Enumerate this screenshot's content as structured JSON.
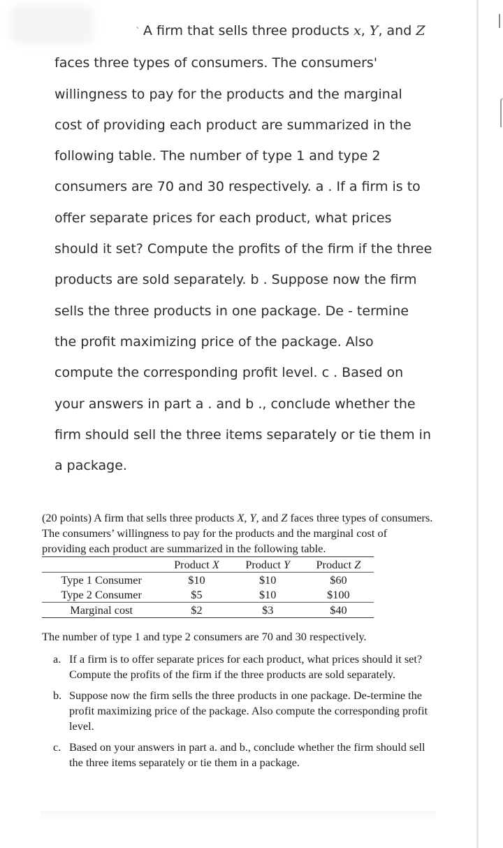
{
  "question": {
    "lines": [
      "A firm that sells three products",
      "faces three types of consumers. The consumers'",
      "willingness to pay for the products and the marginal",
      "cost of providing each product are summarized in the",
      "following table. The number of type 1 and type 2",
      "consumers are 70 and 30 respectively. a . If a firm is to",
      "offer separate prices for each product, what prices",
      "should it set? Compute the profits of the firm if the three",
      "products are sold separately. b . Suppose now the firm",
      "sells the three products in one package. De - termine",
      "the profit maximizing price of the package. Also",
      "compute the corresponding profit level. c . Based on",
      "your answers in part a . and b ., conclude whether the",
      "firm should sell the three items separately or tie them in",
      "a package."
    ],
    "tick": "`",
    "vars": {
      "x": "x",
      "y": "Y",
      "z": "Z",
      "sep1": ", ",
      "sep2": ", and "
    }
  },
  "document": {
    "intro_pre": "(20 points) A firm that sells three products ",
    "intro_x": "X",
    "intro_sep1": ", ",
    "intro_y": "Y",
    "intro_sep2": ", and ",
    "intro_z": "Z",
    "intro_post": " faces three types of consumers. The consumers’ willingness to pay for the products and the marginal cost of providing each product are summarized in the following table.",
    "table": {
      "columns": [
        {
          "prefix": "Product ",
          "var": "X"
        },
        {
          "prefix": "Product ",
          "var": "Y"
        },
        {
          "prefix": "Product ",
          "var": "Z"
        }
      ],
      "rows": [
        {
          "label": "Type 1 Consumer",
          "values": [
            "$10",
            "$10",
            "$60"
          ]
        },
        {
          "label": "Type 2 Consumer",
          "values": [
            "$5",
            "$10",
            "$100"
          ]
        },
        {
          "label": "Marginal cost",
          "values": [
            "$2",
            "$3",
            "$40"
          ]
        }
      ]
    },
    "consumer_counts": "The number of type 1 and type 2 consumers are 70 and 30 respectively.",
    "parts": [
      {
        "marker": "a.",
        "text": "If a firm is to offer separate prices for each product, what prices should it set? Compute the profits of the firm if the three products are sold separately."
      },
      {
        "marker": "b.",
        "text": "Suppose now the firm sells the three products in one package. De-termine the profit maximizing price of the package. Also compute the corresponding profit level."
      },
      {
        "marker": "c.",
        "text": "Based on your answers in part a. and b., conclude whether the firm should sell the three items separately or tie them in a package."
      }
    ]
  }
}
